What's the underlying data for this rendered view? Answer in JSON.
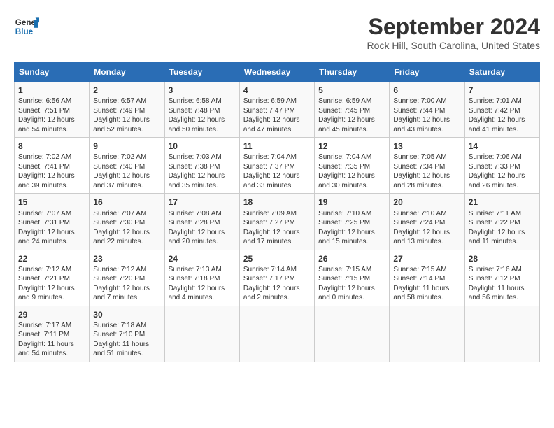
{
  "header": {
    "logo_line1": "General",
    "logo_line2": "Blue",
    "month": "September 2024",
    "location": "Rock Hill, South Carolina, United States"
  },
  "weekdays": [
    "Sunday",
    "Monday",
    "Tuesday",
    "Wednesday",
    "Thursday",
    "Friday",
    "Saturday"
  ],
  "weeks": [
    [
      {
        "day": "1",
        "info": "Sunrise: 6:56 AM\nSunset: 7:51 PM\nDaylight: 12 hours and 54 minutes."
      },
      {
        "day": "2",
        "info": "Sunrise: 6:57 AM\nSunset: 7:49 PM\nDaylight: 12 hours and 52 minutes."
      },
      {
        "day": "3",
        "info": "Sunrise: 6:58 AM\nSunset: 7:48 PM\nDaylight: 12 hours and 50 minutes."
      },
      {
        "day": "4",
        "info": "Sunrise: 6:59 AM\nSunset: 7:47 PM\nDaylight: 12 hours and 47 minutes."
      },
      {
        "day": "5",
        "info": "Sunrise: 6:59 AM\nSunset: 7:45 PM\nDaylight: 12 hours and 45 minutes."
      },
      {
        "day": "6",
        "info": "Sunrise: 7:00 AM\nSunset: 7:44 PM\nDaylight: 12 hours and 43 minutes."
      },
      {
        "day": "7",
        "info": "Sunrise: 7:01 AM\nSunset: 7:42 PM\nDaylight: 12 hours and 41 minutes."
      }
    ],
    [
      {
        "day": "8",
        "info": "Sunrise: 7:02 AM\nSunset: 7:41 PM\nDaylight: 12 hours and 39 minutes."
      },
      {
        "day": "9",
        "info": "Sunrise: 7:02 AM\nSunset: 7:40 PM\nDaylight: 12 hours and 37 minutes."
      },
      {
        "day": "10",
        "info": "Sunrise: 7:03 AM\nSunset: 7:38 PM\nDaylight: 12 hours and 35 minutes."
      },
      {
        "day": "11",
        "info": "Sunrise: 7:04 AM\nSunset: 7:37 PM\nDaylight: 12 hours and 33 minutes."
      },
      {
        "day": "12",
        "info": "Sunrise: 7:04 AM\nSunset: 7:35 PM\nDaylight: 12 hours and 30 minutes."
      },
      {
        "day": "13",
        "info": "Sunrise: 7:05 AM\nSunset: 7:34 PM\nDaylight: 12 hours and 28 minutes."
      },
      {
        "day": "14",
        "info": "Sunrise: 7:06 AM\nSunset: 7:33 PM\nDaylight: 12 hours and 26 minutes."
      }
    ],
    [
      {
        "day": "15",
        "info": "Sunrise: 7:07 AM\nSunset: 7:31 PM\nDaylight: 12 hours and 24 minutes."
      },
      {
        "day": "16",
        "info": "Sunrise: 7:07 AM\nSunset: 7:30 PM\nDaylight: 12 hours and 22 minutes."
      },
      {
        "day": "17",
        "info": "Sunrise: 7:08 AM\nSunset: 7:28 PM\nDaylight: 12 hours and 20 minutes."
      },
      {
        "day": "18",
        "info": "Sunrise: 7:09 AM\nSunset: 7:27 PM\nDaylight: 12 hours and 17 minutes."
      },
      {
        "day": "19",
        "info": "Sunrise: 7:10 AM\nSunset: 7:25 PM\nDaylight: 12 hours and 15 minutes."
      },
      {
        "day": "20",
        "info": "Sunrise: 7:10 AM\nSunset: 7:24 PM\nDaylight: 12 hours and 13 minutes."
      },
      {
        "day": "21",
        "info": "Sunrise: 7:11 AM\nSunset: 7:22 PM\nDaylight: 12 hours and 11 minutes."
      }
    ],
    [
      {
        "day": "22",
        "info": "Sunrise: 7:12 AM\nSunset: 7:21 PM\nDaylight: 12 hours and 9 minutes."
      },
      {
        "day": "23",
        "info": "Sunrise: 7:12 AM\nSunset: 7:20 PM\nDaylight: 12 hours and 7 minutes."
      },
      {
        "day": "24",
        "info": "Sunrise: 7:13 AM\nSunset: 7:18 PM\nDaylight: 12 hours and 4 minutes."
      },
      {
        "day": "25",
        "info": "Sunrise: 7:14 AM\nSunset: 7:17 PM\nDaylight: 12 hours and 2 minutes."
      },
      {
        "day": "26",
        "info": "Sunrise: 7:15 AM\nSunset: 7:15 PM\nDaylight: 12 hours and 0 minutes."
      },
      {
        "day": "27",
        "info": "Sunrise: 7:15 AM\nSunset: 7:14 PM\nDaylight: 11 hours and 58 minutes."
      },
      {
        "day": "28",
        "info": "Sunrise: 7:16 AM\nSunset: 7:12 PM\nDaylight: 11 hours and 56 minutes."
      }
    ],
    [
      {
        "day": "29",
        "info": "Sunrise: 7:17 AM\nSunset: 7:11 PM\nDaylight: 11 hours and 54 minutes."
      },
      {
        "day": "30",
        "info": "Sunrise: 7:18 AM\nSunset: 7:10 PM\nDaylight: 11 hours and 51 minutes."
      },
      {
        "day": "",
        "info": ""
      },
      {
        "day": "",
        "info": ""
      },
      {
        "day": "",
        "info": ""
      },
      {
        "day": "",
        "info": ""
      },
      {
        "day": "",
        "info": ""
      }
    ]
  ]
}
